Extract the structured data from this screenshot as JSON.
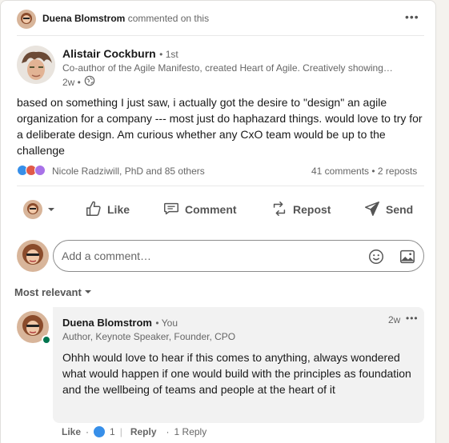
{
  "header": {
    "actor_name": "Duena Blomstrom",
    "actor_action": "commented on this",
    "menu_glyph": "•••"
  },
  "post": {
    "author_name": "Alistair Cockburn",
    "author_degree": "• 1st",
    "author_headline": "Co-author of the Agile Manifesto, created Heart of Agile. Creatively showing…",
    "time": "2w •",
    "body": "based on something I just saw, i actually got the desire to \"design\" an agile organization for a company --- most just do haphazard things. would love to try for a deliberate design. Am curious whether any CxO team would be up to the challenge",
    "reactions_text": "Nicole Radziwill, PhD and 85 others",
    "comments_count": "41 comments",
    "stats_sep": "•",
    "reposts_count": "2 reposts"
  },
  "actions": {
    "like": "Like",
    "comment": "Comment",
    "repost": "Repost",
    "send": "Send"
  },
  "comment_box": {
    "placeholder": "Add a comment…"
  },
  "sort": {
    "label": "Most relevant"
  },
  "comment": {
    "author_name": "Duena Blomstrom",
    "author_tag": "• You",
    "author_headline": "Author, Keynote Speaker, Founder, CPO",
    "time": "2w",
    "menu_glyph": "•••",
    "text": "Ohhh would love to hear if this comes to anything, always wondered what would happen if one would build with the principles as foundation and the wellbeing of teams and people at the heart of it",
    "like_label": "Like",
    "dot1": "·",
    "like_count": "1",
    "pipe": "|",
    "reply_label": "Reply",
    "dot2": "·",
    "replies_count": "1 Reply"
  },
  "colors": {
    "like_blue": "#378fe9",
    "celebrate_red": "#e05a48",
    "love_purple": "#a872e8",
    "online_green": "#01754f"
  },
  "icons": [
    "globe-icon",
    "thumbs-up-icon",
    "speech-bubble-icon",
    "repost-icon",
    "send-icon",
    "emoji-icon",
    "image-icon",
    "caret-down-icon"
  ]
}
